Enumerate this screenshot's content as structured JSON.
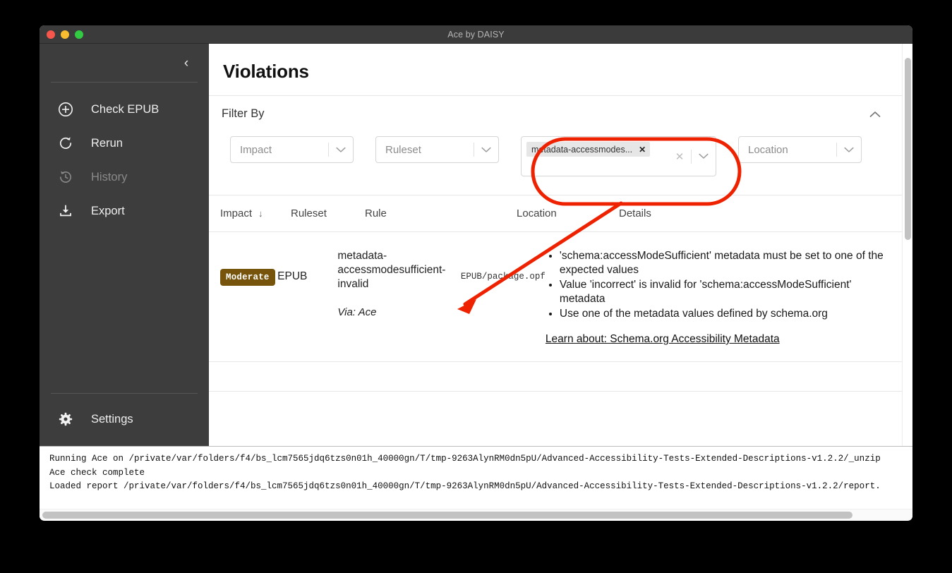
{
  "window": {
    "title": "Ace by DAISY",
    "traffic_lights": [
      "close-red",
      "minimize-yellow",
      "maximize-green"
    ]
  },
  "sidebar": {
    "collapse_icon": "chevron-left-icon",
    "items": [
      {
        "label": "Check EPUB",
        "icon": "plus-circle-icon",
        "disabled": false
      },
      {
        "label": "Rerun",
        "icon": "refresh-icon",
        "disabled": false
      },
      {
        "label": "History",
        "icon": "history-clock-icon",
        "disabled": true
      },
      {
        "label": "Export",
        "icon": "download-icon",
        "disabled": false
      }
    ],
    "bottom": {
      "label": "Settings",
      "icon": "gear-icon"
    }
  },
  "main": {
    "page_title": "Violations",
    "filter": {
      "heading": "Filter By",
      "collapse_icon": "chevron-up-icon",
      "selects": [
        {
          "name": "impact",
          "placeholder": "Impact",
          "value": ""
        },
        {
          "name": "ruleset",
          "placeholder": "Ruleset",
          "value": ""
        },
        {
          "name": "location",
          "placeholder": "Location",
          "value": ""
        }
      ],
      "rule_multiselect": {
        "name": "rule",
        "chips": [
          {
            "label": "metadata-accessmodes...",
            "remove_icon": "close-x-icon"
          }
        ],
        "clear_icon": "clear-x-icon",
        "caret_icon": "chevron-down-icon"
      }
    },
    "table": {
      "columns": [
        "Impact",
        "Ruleset",
        "Rule",
        "Location",
        "Details"
      ],
      "sort_column": "Impact",
      "sort_icon": "arrow-down-icon",
      "rows": [
        {
          "impact": "Moderate",
          "impact_color": "#77540c",
          "ruleset": "EPUB",
          "rule": "metadata-accessmodesufficient-invalid",
          "via": "Via: Ace",
          "location": "EPUB/package.opf",
          "details": [
            "'schema:accessModeSufficient' metadata must be set to one of the expected values",
            "Value 'incorrect' is invalid for 'schema:accessModeSufficient' metadata",
            "Use one of the metadata values defined by schema.org"
          ],
          "learn_link": "Learn about: Schema.org Accessibility Metadata"
        }
      ]
    }
  },
  "terminal": {
    "lines": [
      "Running Ace on /private/var/folders/f4/bs_lcm7565jdq6tzs0n01h_40000gn/T/tmp-9263AlynRM0dn5pU/Advanced-Accessibility-Tests-Extended-Descriptions-v1.2.2/_unzip",
      "Ace check complete",
      "Loaded report /private/var/folders/f4/bs_lcm7565jdq6tzs0n01h_40000gn/T/tmp-9263AlynRM0dn5pU/Advanced-Accessibility-Tests-Extended-Descriptions-v1.2.2/report."
    ]
  },
  "annotations": {
    "highlight_color": "#ee2200",
    "highlight_target": "rule-multiselect",
    "arrow_target": "rule-cell"
  }
}
